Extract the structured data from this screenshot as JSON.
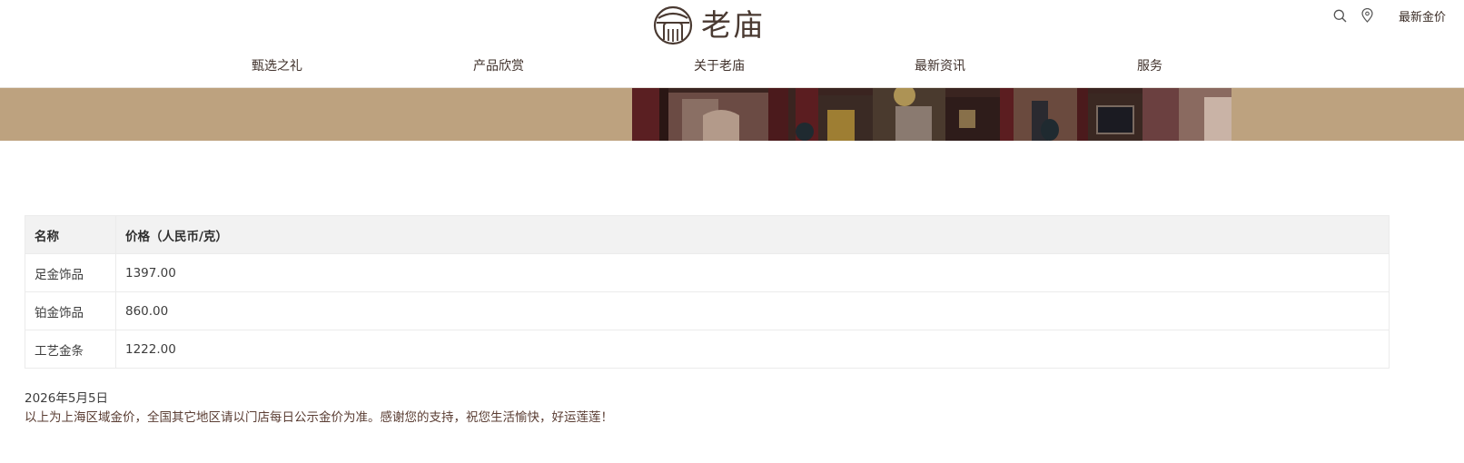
{
  "header": {
    "logo_text": "老庙",
    "gold_price_link": "最新金价"
  },
  "icons": {
    "search": "search-icon",
    "location": "location-pin-icon",
    "logo": "laomiao-logo-icon"
  },
  "nav": {
    "items": [
      {
        "label": "甄选之礼"
      },
      {
        "label": "产品欣赏"
      },
      {
        "label": "关于老庙"
      },
      {
        "label": "最新资讯"
      },
      {
        "label": "服务"
      }
    ]
  },
  "colors": {
    "brand": "#4a3a32",
    "banner_bg": "#bda27f",
    "table_header_bg": "#f2f2f2",
    "note_text": "#5a3d33"
  },
  "table": {
    "headers": [
      "名称",
      "价格（人民币/克）"
    ],
    "rows": [
      {
        "name": "足金饰品",
        "price": "1397.00"
      },
      {
        "name": "铂金饰品",
        "price": "860.00"
      },
      {
        "name": "工艺金条",
        "price": "1222.00"
      }
    ]
  },
  "footer": {
    "date": "2026年5月5日",
    "note": "以上为上海区域金价，全国其它地区请以门店每日公示金价为准。感谢您的支持，祝您生活愉快，好运莲莲！"
  }
}
